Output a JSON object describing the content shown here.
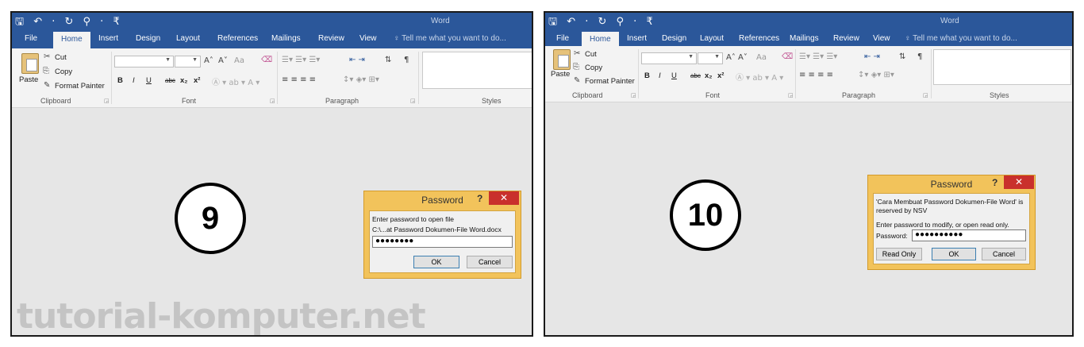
{
  "panels": [
    {
      "qat": "🖫 ↶ · ↻ ⚲ · ₹",
      "window_title": "Word",
      "tabs": [
        "File",
        "Home",
        "Insert",
        "Design",
        "Layout",
        "References",
        "Mailings",
        "Review",
        "View"
      ],
      "active_tab": "Home",
      "tell_me": "Tell me what you want to do...",
      "clipboard": {
        "paste": "Paste",
        "cut": "Cut",
        "copy": "Copy",
        "format_painter": "Format Painter",
        "label": "Clipboard"
      },
      "font": {
        "bold": "B",
        "italic": "I",
        "underline": "U",
        "strike": "abc",
        "sub": "x₂",
        "sup": "x²",
        "label": "Font",
        "grow": "A˄",
        "shrink": "A˅",
        "aa": "Aa"
      },
      "paragraph": {
        "label": "Paragraph"
      },
      "styles": {
        "label": "Styles"
      },
      "step_number": "9",
      "dialog": {
        "title": "Password",
        "help": "?",
        "close": "✕",
        "line1": "Enter password to open file",
        "line2": "C:\\...at Password Dokumen-File Word.docx",
        "password_value": "●●●●●●●●",
        "ok": "OK",
        "cancel": "Cancel"
      },
      "watermark": "tutorial-komputer.net"
    },
    {
      "qat": "🖫 ↶ · ↻ ⚲ · ₹",
      "window_title": "Word",
      "tabs": [
        "File",
        "Home",
        "Insert",
        "Design",
        "Layout",
        "References",
        "Mailings",
        "Review",
        "View"
      ],
      "active_tab": "Home",
      "tell_me": "Tell me what you want to do...",
      "clipboard": {
        "paste": "Paste",
        "cut": "Cut",
        "copy": "Copy",
        "format_painter": "Format Painter",
        "label": "Clipboard"
      },
      "font": {
        "label": "Font"
      },
      "paragraph": {
        "label": "Paragraph"
      },
      "styles": {
        "label": "Styles"
      },
      "step_number": "10",
      "dialog": {
        "title": "Password",
        "help": "?",
        "close": "✕",
        "line1": "'Cara Membuat Password Dokumen-File Word' is",
        "line2": "reserved by NSV",
        "line3": "Enter password to modify, or open read only.",
        "password_label": "Password:",
        "password_value": "●●●●●●●●●●",
        "read_only": "Read Only",
        "ok": "OK",
        "cancel": "Cancel"
      }
    }
  ],
  "colors": {
    "ribbon_blue": "#2b579a",
    "dialog_border": "#f2c35b",
    "close_red": "#c9302c"
  }
}
